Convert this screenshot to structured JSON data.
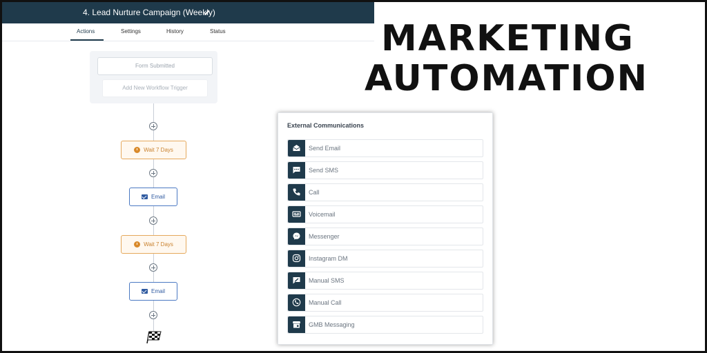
{
  "header": {
    "title": "4. Lead Nurture Campaign (Weekly)"
  },
  "tabs": [
    {
      "label": "Actions",
      "active": true
    },
    {
      "label": "Settings",
      "active": false
    },
    {
      "label": "History",
      "active": false
    },
    {
      "label": "Status",
      "active": false
    }
  ],
  "workflow": {
    "trigger_label": "Form Submitted",
    "add_trigger_label": "Add New Workflow Trigger",
    "steps": [
      {
        "type": "wait",
        "label": "Wait 7 Days"
      },
      {
        "type": "email",
        "label": "Email"
      },
      {
        "type": "wait",
        "label": "Wait 7 Days"
      },
      {
        "type": "email",
        "label": "Email"
      }
    ]
  },
  "headline": {
    "line1": "MARKETING",
    "line2": "AUTOMATION"
  },
  "panel": {
    "title": "External Communications",
    "items": [
      {
        "label": "Send Email",
        "icon": "envelope-open-icon"
      },
      {
        "label": "Send SMS",
        "icon": "chat-bubble-icon"
      },
      {
        "label": "Call",
        "icon": "phone-icon"
      },
      {
        "label": "Voicemail",
        "icon": "voicemail-icon"
      },
      {
        "label": "Messenger",
        "icon": "messenger-icon"
      },
      {
        "label": "Instagram DM",
        "icon": "instagram-icon"
      },
      {
        "label": "Manual SMS",
        "icon": "manual-sms-icon"
      },
      {
        "label": "Manual Call",
        "icon": "manual-call-icon"
      },
      {
        "label": "GMB Messaging",
        "icon": "storefront-icon"
      }
    ]
  },
  "colors": {
    "header_bg": "#1f3a4b",
    "wait_accent": "#e5a85b",
    "email_accent": "#4a78c2"
  }
}
